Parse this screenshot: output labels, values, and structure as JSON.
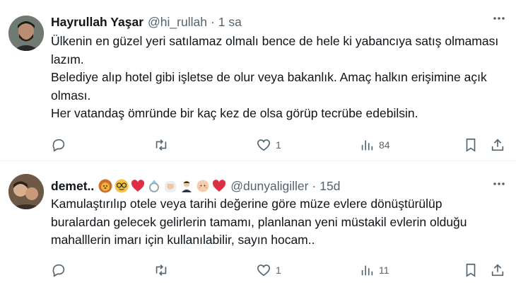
{
  "tweets": [
    {
      "author_name": "Hayrullah Yaşar",
      "handle": "@hi_rullah",
      "separator": "·",
      "time": "1 sa",
      "lines": [
        "Ülkenin en güzel yeri satılamaz olmalı bence de hele ki yabancıya satış olmaması lazım.",
        "Belediye alıp hotel gibi işletse de olur veya bakanlık. Amaç halkın erişimine açık olması.",
        "Her vatandaş ömründe bir kaç kez de olsa görüp tecrübe edebilsin."
      ],
      "likes": "1",
      "views": "84"
    },
    {
      "author_name": "demet..",
      "handle": "@dunyaligiller",
      "separator": "·",
      "time": "15d",
      "emojis": [
        "lion-face",
        "nerd-face",
        "red-heart",
        "ring",
        "person-with-veil",
        "man-in-tuxedo",
        "baby",
        "red-heart"
      ],
      "lines": [
        "Kamulaştırılıp otele veya tarihi değerine göre müze evlere dönüştürülüp buralardan gelecek gelirlerin tamamı, planlanan yeni müstakil evlerin olduğu mahalllerin imarı için kullanılabilir, sayın hocam.."
      ],
      "likes": "1",
      "views": "11"
    }
  ],
  "colors": {
    "text": "#0f1419",
    "secondary": "#536471",
    "divider": "#eff3f4",
    "heart": "#e0245e"
  }
}
